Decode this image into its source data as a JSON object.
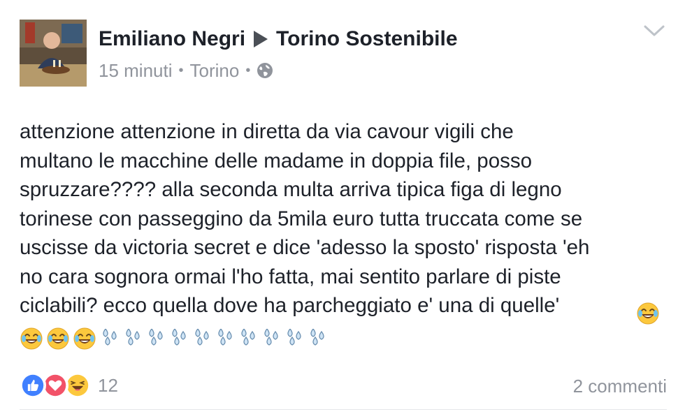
{
  "post": {
    "author": "Emiliano Negri",
    "group": "Torino Sostenibile",
    "time": "15 minuti",
    "location": "Torino",
    "privacy_icon": "globe-icon",
    "message": "attenzione attenzione in diretta da via cavour vigili che\nmultano le macchine delle madame in doppia file, posso\nspruzzare???? alla seconda multa arriva tipica figa di legno\ntorinese con passeggino da 5mila euro tutta truccata come se\nuscisse da victoria secret e dice 'adesso la sposto' risposta 'eh\nno cara sognora ormai l'ho fatta, mai sentito parlare di piste\nciclabili? ecco quella dove ha parcheggiato e' una di quelle'",
    "emoji": {
      "inline_laughing_count": 1,
      "trailing_laughing_count": 3,
      "sweat_drops_count": 10
    }
  },
  "footer": {
    "reaction_icons": [
      "like-icon",
      "love-icon",
      "haha-icon"
    ],
    "reaction_count": "12",
    "comments": "2 commenti"
  },
  "colors": {
    "text": "#1d2129",
    "secondary": "#90949c",
    "like": "#4080ff",
    "love": "#f25268",
    "haha": "#fcc83d"
  }
}
